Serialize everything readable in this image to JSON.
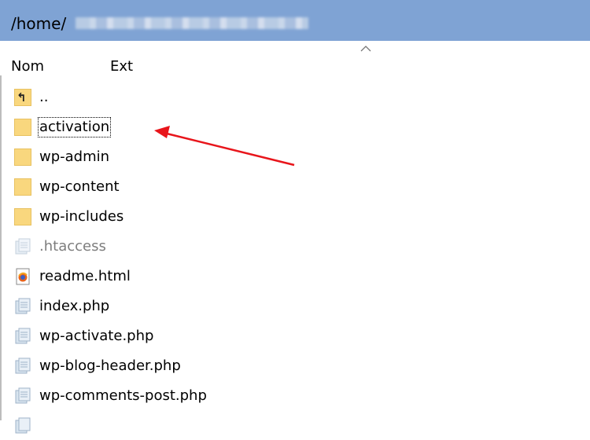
{
  "path_bar": {
    "path_prefix": "/home/"
  },
  "columns": {
    "name": "Nom",
    "ext": "Ext"
  },
  "files": [
    {
      "name": "..",
      "icon": "parent-folder-icon",
      "type": "parent"
    },
    {
      "name": "activation",
      "icon": "folder-icon",
      "type": "folder",
      "focused": true
    },
    {
      "name": "wp-admin",
      "icon": "folder-icon",
      "type": "folder"
    },
    {
      "name": "wp-content",
      "icon": "folder-icon",
      "type": "folder"
    },
    {
      "name": "wp-includes",
      "icon": "folder-icon",
      "type": "folder"
    },
    {
      "name": ".htaccess",
      "icon": "generic-file-icon",
      "type": "file",
      "hidden": true
    },
    {
      "name": "readme.html",
      "icon": "html-file-icon",
      "type": "file"
    },
    {
      "name": "index.php",
      "icon": "generic-file-icon",
      "type": "file"
    },
    {
      "name": "wp-activate.php",
      "icon": "generic-file-icon",
      "type": "file"
    },
    {
      "name": "wp-blog-header.php",
      "icon": "generic-file-icon",
      "type": "file"
    },
    {
      "name": "wp-comments-post.php",
      "icon": "generic-file-icon",
      "type": "file"
    }
  ],
  "annotation": {
    "color": "#e8151b",
    "target": "activation"
  }
}
